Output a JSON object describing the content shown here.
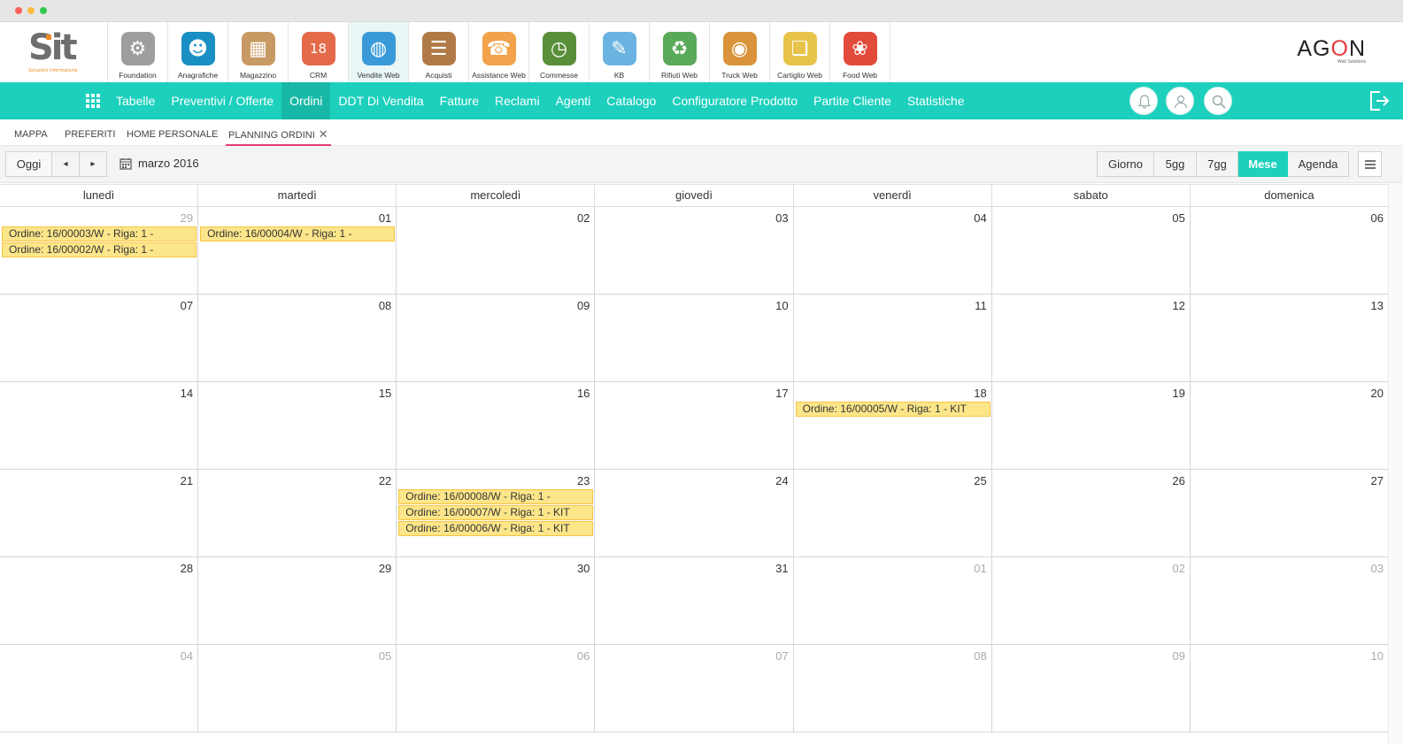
{
  "brand": {
    "logo_text": "Sit",
    "logo_sub": "Soluzioni Informatiche",
    "right_logo_a": "AG",
    "right_logo_o": "O",
    "right_logo_b": "N",
    "right_logo_sub": "Web Solutions"
  },
  "modules": [
    {
      "label": "Foundation",
      "icon": "gear-icon",
      "color": "#9e9e9e",
      "glyph": "⚙"
    },
    {
      "label": "Anagrafiche",
      "icon": "address-book-icon",
      "color": "#1a8fc4",
      "glyph": "☻"
    },
    {
      "label": "Magazzino",
      "icon": "boxes-icon",
      "color": "#c89a63",
      "glyph": "▦"
    },
    {
      "label": "CRM",
      "icon": "calendar-chart-icon",
      "color": "#e46a4a",
      "glyph": "18"
    },
    {
      "label": "Vendite Web",
      "icon": "globe-handshake-icon",
      "color": "#3a9ad9",
      "glyph": "◍"
    },
    {
      "label": "Acquisti",
      "icon": "clipboard-bag-icon",
      "color": "#b07a46",
      "glyph": "☰"
    },
    {
      "label": "Assistance Web",
      "icon": "headset-icon",
      "color": "#f2a24a",
      "glyph": "☎"
    },
    {
      "label": "Commesse",
      "icon": "clock-money-icon",
      "color": "#5a8f3a",
      "glyph": "◷"
    },
    {
      "label": "KB",
      "icon": "knowledge-base-icon",
      "color": "#6bb3e0",
      "glyph": "✎"
    },
    {
      "label": "Rifiuti Web",
      "icon": "recycle-bin-icon",
      "color": "#5aa85a",
      "glyph": "♻"
    },
    {
      "label": "Truck Web",
      "icon": "globe-box-icon",
      "color": "#d9943a",
      "glyph": "◉"
    },
    {
      "label": "Cartiglio Web",
      "icon": "documents-icon",
      "color": "#e8c34a",
      "glyph": "❏"
    },
    {
      "label": "Food Web",
      "icon": "fruit-icon",
      "color": "#e24a3a",
      "glyph": "❀"
    }
  ],
  "nav": {
    "items": [
      "Tabelle",
      "Preventivi / Offerte",
      "Ordini",
      "DDT Di Vendita",
      "Fatture",
      "Reclami",
      "Agenti",
      "Catalogo",
      "Configuratore Prodotto",
      "Partite Cliente",
      "Statistiche"
    ],
    "active": "Ordini"
  },
  "tabs": {
    "mappa": "MAPPA",
    "preferiti": "PREFERITI",
    "home": "HOME PERSONALE",
    "planning": "PLANNING ORDINI",
    "close": "✕"
  },
  "toolbar": {
    "today": "Oggi",
    "prev": "◂",
    "next": "▸",
    "month": "marzo 2016",
    "views": [
      "Giorno",
      "5gg",
      "7gg",
      "Mese",
      "Agenda"
    ],
    "active_view": "Mese"
  },
  "calendar": {
    "weekdays": [
      "lunedì",
      "martedì",
      "mercoledì",
      "giovedì",
      "venerdì",
      "sabato",
      "domenica"
    ],
    "weeks": [
      [
        {
          "d": "29",
          "other": true,
          "events": [
            "Ordine: 16/00003/W - Riga: 1 -",
            "Ordine: 16/00002/W - Riga: 1 -"
          ]
        },
        {
          "d": "01",
          "events": [
            "Ordine: 16/00004/W - Riga: 1 -"
          ]
        },
        {
          "d": "02"
        },
        {
          "d": "03"
        },
        {
          "d": "04"
        },
        {
          "d": "05"
        },
        {
          "d": "06"
        }
      ],
      [
        {
          "d": "07"
        },
        {
          "d": "08"
        },
        {
          "d": "09"
        },
        {
          "d": "10"
        },
        {
          "d": "11"
        },
        {
          "d": "12"
        },
        {
          "d": "13"
        }
      ],
      [
        {
          "d": "14"
        },
        {
          "d": "15"
        },
        {
          "d": "16"
        },
        {
          "d": "17"
        },
        {
          "d": "18",
          "events": [
            "Ordine: 16/00005/W - Riga: 1 - KIT"
          ]
        },
        {
          "d": "19"
        },
        {
          "d": "20"
        }
      ],
      [
        {
          "d": "21"
        },
        {
          "d": "22"
        },
        {
          "d": "23",
          "events": [
            "Ordine: 16/00008/W - Riga: 1 -",
            "Ordine: 16/00007/W - Riga: 1 - KIT",
            "Ordine: 16/00006/W - Riga: 1 - KIT"
          ]
        },
        {
          "d": "24"
        },
        {
          "d": "25"
        },
        {
          "d": "26"
        },
        {
          "d": "27"
        }
      ],
      [
        {
          "d": "28"
        },
        {
          "d": "29"
        },
        {
          "d": "30"
        },
        {
          "d": "31"
        },
        {
          "d": "01",
          "other": true
        },
        {
          "d": "02",
          "other": true
        },
        {
          "d": "03",
          "other": true
        }
      ],
      [
        {
          "d": "04",
          "other": true
        },
        {
          "d": "05",
          "other": true
        },
        {
          "d": "06",
          "other": true
        },
        {
          "d": "07",
          "other": true
        },
        {
          "d": "08",
          "other": true
        },
        {
          "d": "09",
          "other": true
        },
        {
          "d": "10",
          "other": true
        }
      ]
    ]
  }
}
